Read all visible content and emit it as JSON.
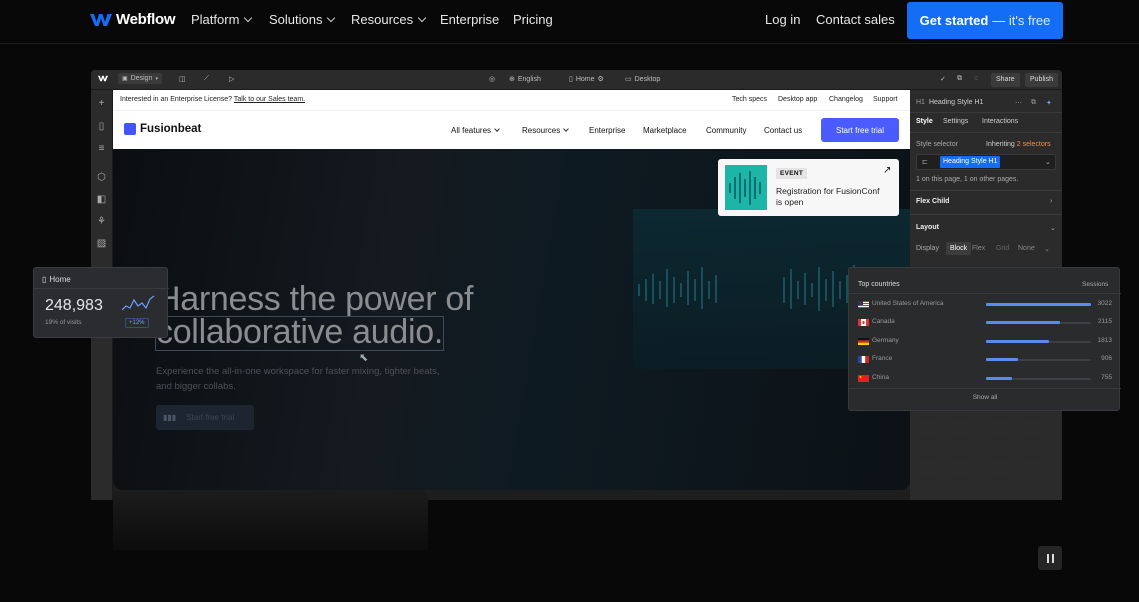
{
  "nav": {
    "brand": "Webflow",
    "items": [
      {
        "label": "Platform",
        "dropdown": true
      },
      {
        "label": "Solutions",
        "dropdown": true
      },
      {
        "label": "Resources",
        "dropdown": true
      },
      {
        "label": "Enterprise",
        "dropdown": false
      },
      {
        "label": "Pricing",
        "dropdown": false
      }
    ],
    "login": "Log in",
    "contact": "Contact sales",
    "cta_main": "Get started",
    "cta_sub": "— it's free",
    "accent": "#146ef5"
  },
  "editor_toolbar": {
    "mode": "Design",
    "locale": "English",
    "page": "Home",
    "breakpoint": "Desktop",
    "share": "Share",
    "publish": "Publish"
  },
  "site": {
    "announcement": "Interested in an Enterprise License?",
    "announcement_link": "Talk to our Sales team.",
    "utility_links": [
      "Tech specs",
      "Desktop app",
      "Changelog",
      "Support"
    ],
    "brand": "Fusionbeat",
    "nav": [
      "All features",
      "Resources",
      "Enterprise",
      "Marketplace",
      "Community",
      "Contact us"
    ],
    "trial": "Start free trial",
    "event_tag": "EVENT",
    "event_title": "Registration for FusionConf is open",
    "headline_line1": "Harness the power of",
    "headline_line2": "collaborative audio.",
    "subcopy": "Experience the all-in-one workspace for faster mixing, tighter beats, and bigger collabs.",
    "hero_button": "Start free trial"
  },
  "style_panel": {
    "element": "Heading Style H1",
    "tag": "H1",
    "tabs": [
      "Style",
      "Settings",
      "Interactions"
    ],
    "selector_label": "Style selector",
    "inheriting": "Inheriting",
    "inheriting_count": "2 selectors",
    "selector": "Heading Style H1",
    "usage": "1 on this page, 1 on other pages.",
    "section_flex": "Flex Child",
    "section_layout": "Layout",
    "display_label": "Display",
    "display_options": [
      "Block",
      "Flex",
      "Grid",
      "None"
    ]
  },
  "home_card": {
    "title": "Home",
    "value": "248,983",
    "sub": "19% of visits",
    "badge": "+12%"
  },
  "countries": {
    "title": "Top countries",
    "column": "Sessions",
    "rows": [
      {
        "name": "United States of America",
        "value": "3022",
        "fraction": 1.0,
        "flag": "us"
      },
      {
        "name": "Canada",
        "value": "2115",
        "fraction": 0.7,
        "flag": "ca"
      },
      {
        "name": "Germany",
        "value": "1813",
        "fraction": 0.6,
        "flag": "de"
      },
      {
        "name": "France",
        "value": "906",
        "fraction": 0.3,
        "flag": "fr"
      },
      {
        "name": "China",
        "value": "755",
        "fraction": 0.25,
        "flag": "cn"
      }
    ],
    "show_all": "Show all",
    "bar_color": "#5a8cf0"
  }
}
